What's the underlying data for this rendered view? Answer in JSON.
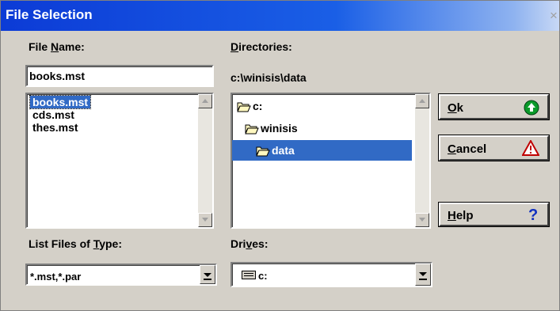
{
  "window": {
    "title": "File Selection",
    "close_glyph": "×"
  },
  "file_name": {
    "label_pre": "File ",
    "label_key": "N",
    "label_post": "ame:",
    "value": "books.mst",
    "files": [
      "books.mst",
      "cds.mst",
      "thes.mst"
    ],
    "selected_index": 0
  },
  "directories": {
    "label_key": "D",
    "label_post": "irectories:",
    "current_path": "c:\\winisis\\data",
    "items": [
      {
        "name": "c:",
        "icon": "open-folder-icon"
      },
      {
        "name": "winisis",
        "icon": "open-folder-icon"
      },
      {
        "name": "data",
        "icon": "open-folder-icon"
      }
    ],
    "selected_index": 2
  },
  "file_type": {
    "label_pre": "List Files of ",
    "label_key": "T",
    "label_post": "ype:",
    "value": "*.mst,*.par"
  },
  "drives": {
    "label_pre": "Dri",
    "label_key": "v",
    "label_post": "es:",
    "value": "c:",
    "icon": "drive-icon"
  },
  "buttons": {
    "ok": {
      "key": "O",
      "rest": "k",
      "icon": "green-up-arrow-icon"
    },
    "cancel": {
      "key": "C",
      "rest": "ancel",
      "icon": "warning-triangle-icon"
    },
    "help": {
      "key": "H",
      "rest": "elp",
      "icon": "question-mark-icon"
    }
  },
  "colors": {
    "title_bar": "#0c3bd6",
    "selection": "#316ac5",
    "face": "#d4d0c8"
  }
}
